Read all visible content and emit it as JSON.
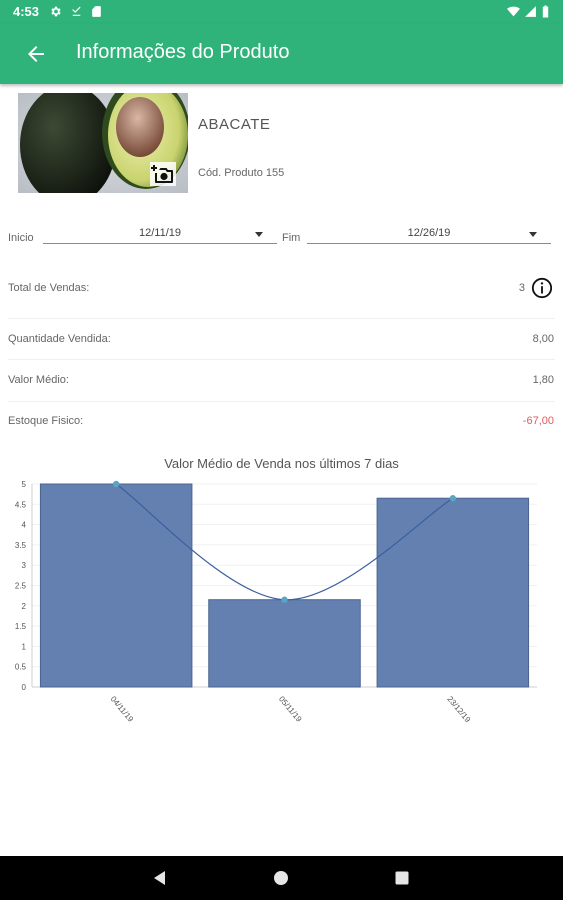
{
  "status_bar": {
    "time": "4:53",
    "icons": [
      "gear-icon",
      "download-done-icon",
      "sd-card-icon",
      "wifi-icon",
      "signal-icon",
      "battery-icon"
    ]
  },
  "app_bar": {
    "title": "Informações do Produto",
    "back_icon": "arrow-back-icon"
  },
  "product": {
    "name": "ABACATE",
    "code": "Cód. Produto 155",
    "photo_icon": "add-photo-icon"
  },
  "filters": {
    "start_label": "Inicio",
    "start_value": "12/11/19",
    "end_label": "Fim",
    "end_value": "12/26/19"
  },
  "stats": {
    "total_sales_label": "Total de Vendas:",
    "total_sales_value": "3",
    "quantity_label": "Quantidade Vendida:",
    "quantity_value": "8,00",
    "avg_value_label": "Valor Médio:",
    "avg_value_value": "1,80",
    "stock_label": "Estoque Fisico:",
    "stock_value": "-67,00"
  },
  "colors": {
    "primary": "#2fb37a",
    "negative": "#e25a5a",
    "bar": "#6380b0",
    "line": "#3a5fa0",
    "point": "#5aa5c4"
  },
  "chart_data": {
    "type": "bar",
    "title": "Valor Médio de Venda nos últimos 7 dias",
    "categories": [
      "04/11/19",
      "05/11/19",
      "23/12/19"
    ],
    "values": [
      5.0,
      2.15,
      4.65
    ],
    "line_overlay": [
      5.0,
      2.15,
      4.65
    ],
    "ylim": [
      0,
      5
    ],
    "yticks": [
      "0",
      "0.5",
      "1",
      "1.5",
      "2",
      "2.5",
      "3",
      "3.5",
      "4",
      "4.5",
      "5"
    ],
    "xlabel": "",
    "ylabel": "",
    "grid": true
  },
  "nav_bar": {
    "icons": [
      "back-triangle-icon",
      "home-circle-icon",
      "recents-square-icon"
    ]
  }
}
